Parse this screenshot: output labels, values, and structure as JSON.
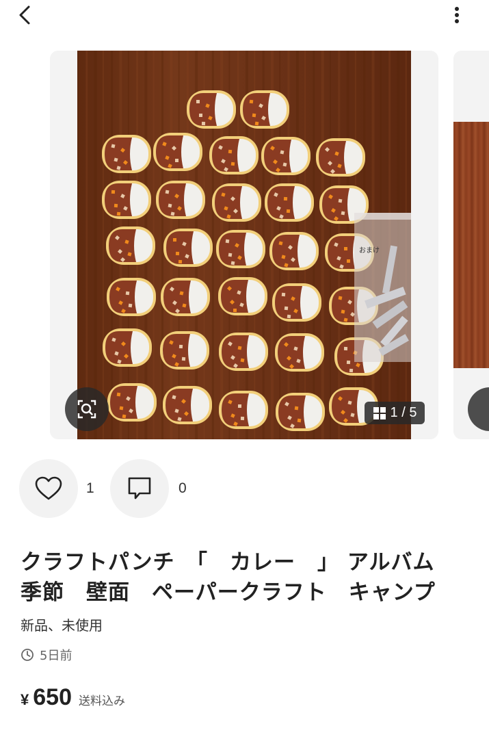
{
  "nav": {
    "back_icon": "chevron-left-icon",
    "more_icon": "vertical-dots-icon"
  },
  "gallery": {
    "current": 1,
    "total": 5,
    "counter_text": "1 / 5",
    "colors": {
      "wood": "#6e3315",
      "curry": "#8a3b22",
      "rice": "#f1f0ec",
      "plate": "#f2cf7a",
      "star": "#f08a1c"
    }
  },
  "actions": {
    "likes": {
      "icon": "heart-icon",
      "count": "1"
    },
    "comments": {
      "icon": "comment-icon",
      "count": "0"
    }
  },
  "item": {
    "title_line1": "クラフトパンチ　「　カレー　」 アルバム",
    "title_line2": "季節　壁面　ペーパークラフト　キャンプ",
    "condition": "新品、未使用",
    "posted": "5日前",
    "currency": "¥",
    "price": "650",
    "shipping": "送料込み"
  }
}
